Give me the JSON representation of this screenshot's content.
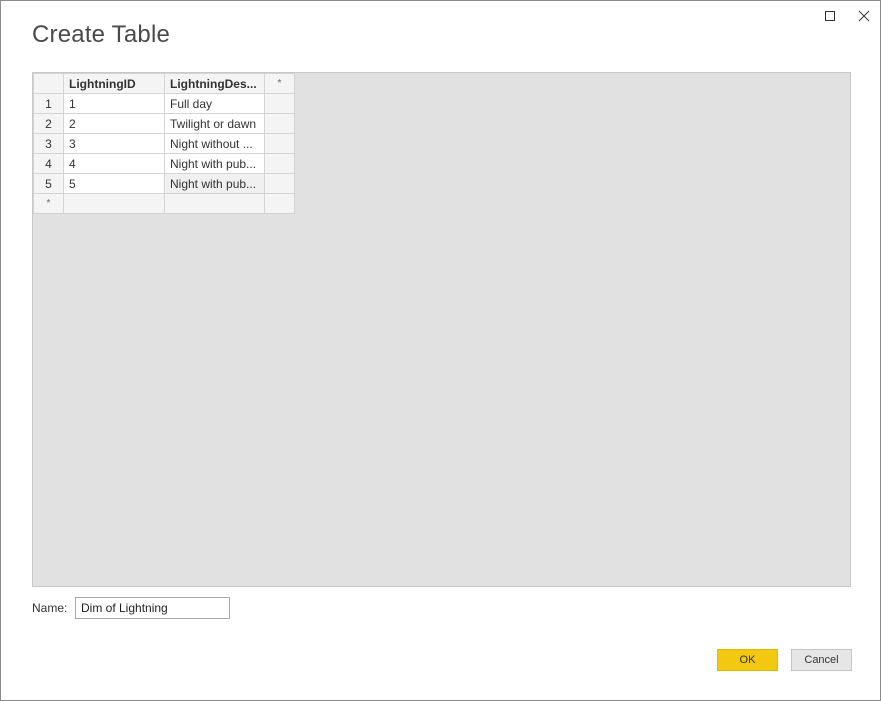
{
  "dialog": {
    "title": "Create Table"
  },
  "window_controls": {
    "maximize_icon": "maximize-icon",
    "close_icon": "close-icon"
  },
  "grid": {
    "columns": [
      "LightningID",
      "LightningDes...",
      "*"
    ],
    "rows": [
      {
        "num": "1",
        "id": "1",
        "desc": "Full day"
      },
      {
        "num": "2",
        "id": "2",
        "desc": "Twilight or dawn"
      },
      {
        "num": "3",
        "id": "3",
        "desc": "Night without ..."
      },
      {
        "num": "4",
        "id": "4",
        "desc": "Night with pub..."
      },
      {
        "num": "5",
        "id": "5",
        "desc": "Night with pub..."
      }
    ],
    "new_row_marker": "*"
  },
  "name_field": {
    "label": "Name:",
    "value": "Dim of Lightning"
  },
  "buttons": {
    "ok": "OK",
    "cancel": "Cancel"
  },
  "colors": {
    "accent": "#f2c811",
    "grid_background": "#e1e1e1"
  }
}
